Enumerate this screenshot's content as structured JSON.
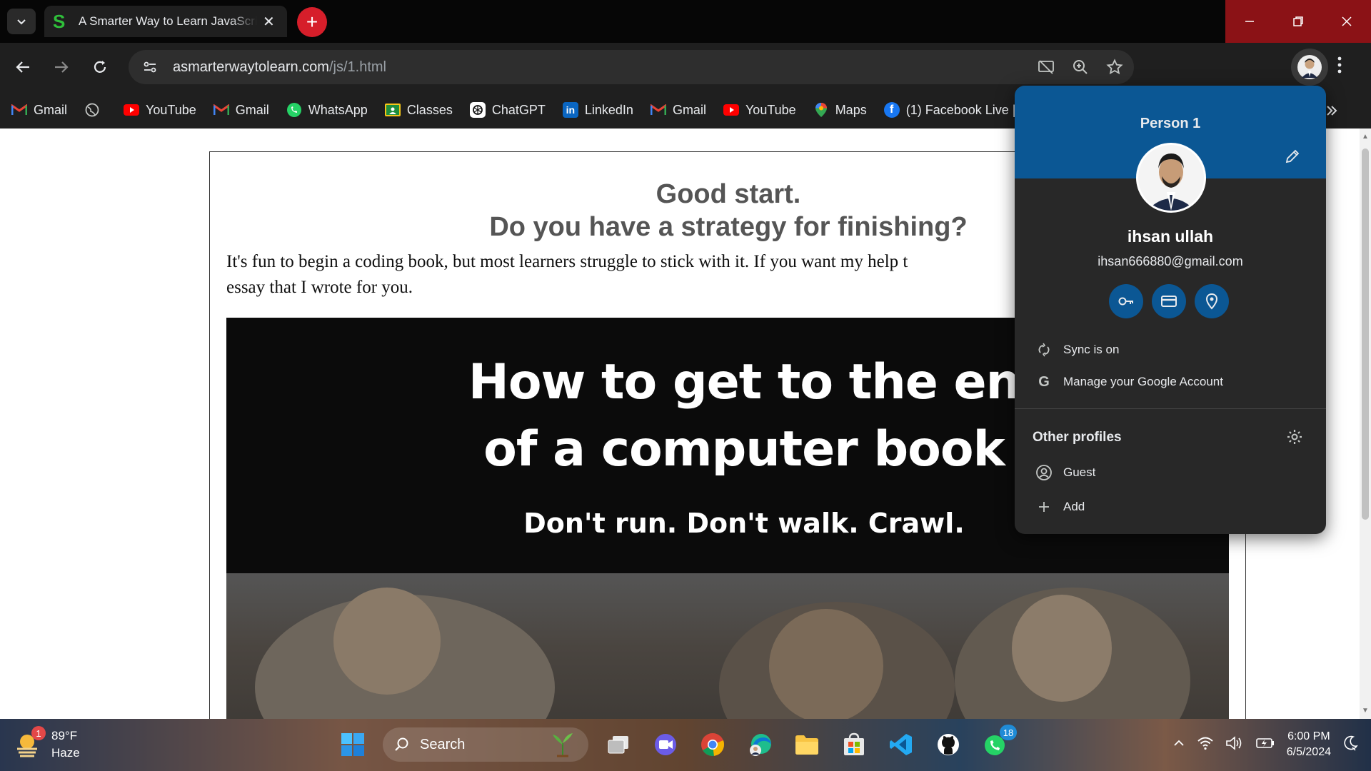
{
  "tab": {
    "title": "A Smarter Way to Learn JavaScript",
    "favicon_letter": "S"
  },
  "window_controls": [
    "minimize-icon",
    "restore-icon",
    "close-icon"
  ],
  "toolbar": {
    "url_domain": "asmarterwaytolearn.com",
    "url_path": "/js/1.html"
  },
  "bookmarks": [
    {
      "label": "Gmail",
      "icon": "gmail-icon"
    },
    {
      "label": "",
      "icon": "globe-icon"
    },
    {
      "label": "YouTube",
      "icon": "youtube-icon"
    },
    {
      "label": "Gmail",
      "icon": "gmail-icon"
    },
    {
      "label": "WhatsApp",
      "icon": "whatsapp-icon"
    },
    {
      "label": "Classes",
      "icon": "classroom-icon"
    },
    {
      "label": "ChatGPT",
      "icon": "chatgpt-icon"
    },
    {
      "label": "LinkedIn",
      "icon": "linkedin-icon"
    },
    {
      "label": "Gmail",
      "icon": "gmail-icon"
    },
    {
      "label": "YouTube",
      "icon": "youtube-icon"
    },
    {
      "label": "Maps",
      "icon": "maps-icon"
    },
    {
      "label": "(1) Facebook Live |",
      "icon": "facebook-icon"
    }
  ],
  "page": {
    "headline_line1": "Good start.",
    "headline_line2": "Do you have a strategy for finishing?",
    "body_line1": "It's fun to begin a coding book, but most learners struggle to stick with it. If you want my help t",
    "body_line2": "essay that I wrote for you.",
    "hero_title_line1": "How to get to the en",
    "hero_title_line2": "of a computer book",
    "hero_subtitle": "Don't run. Don't walk. Crawl."
  },
  "profile_popup": {
    "header": "Person 1",
    "name": "ihsan ullah",
    "email": "ihsan666880@gmail.com",
    "quick_actions": [
      "password-key-icon",
      "payment-card-icon",
      "location-pin-icon"
    ],
    "sync_label": "Sync is on",
    "manage_label": "Manage your Google Account",
    "other_profiles_label": "Other profiles",
    "guest_label": "Guest",
    "add_label": "Add"
  },
  "taskbar": {
    "weather_temp": "89°F",
    "weather_desc": "Haze",
    "weather_badge": "1",
    "search_label": "Search",
    "whatsapp_badge": "18",
    "time": "6:00 PM",
    "date": "6/5/2024"
  },
  "colors": {
    "popup_accent": "#0b5794",
    "new_tab_red": "#d61e2a",
    "window_controls_red": "#8b1216"
  }
}
